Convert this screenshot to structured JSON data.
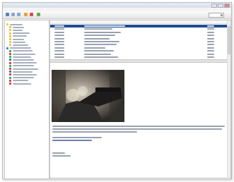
{
  "window": {
    "title": ""
  },
  "menu": [
    "",
    "",
    "",
    "",
    "",
    ""
  ],
  "toolbar": {
    "search_placeholder": ""
  },
  "colors": {
    "selection": "#1f4d8f",
    "folder": "#f0c23b",
    "error": "#d33",
    "accent": "#2f63b6"
  },
  "sidebar": {
    "items": [
      {
        "icon": "folder-icon",
        "color": "#f0c23b"
      },
      {
        "icon": "folder-icon",
        "color": "#f0c23b"
      },
      {
        "icon": "folder-icon",
        "color": "#f0c23b"
      },
      {
        "icon": "folder-icon",
        "color": "#f0c23b"
      },
      {
        "icon": "folder-icon",
        "color": "#f0c23b"
      },
      {
        "icon": "folder-icon",
        "color": "#f0c23b"
      },
      {
        "icon": "folder-icon",
        "color": "#f0c23b"
      },
      {
        "icon": "folder-icon",
        "color": "#f0c23b"
      },
      {
        "icon": "mail-icon",
        "color": "#3b7bd6"
      },
      {
        "icon": "feed-icon",
        "color": "#2da84a"
      },
      {
        "icon": "feed-icon",
        "color": "#d33"
      },
      {
        "icon": "feed-icon",
        "color": "#2da84a"
      },
      {
        "icon": "feed-icon",
        "color": "#2f63b6"
      },
      {
        "icon": "feed-icon",
        "color": "#d33"
      },
      {
        "icon": "feed-icon",
        "color": "#2da84a"
      },
      {
        "icon": "feed-icon",
        "color": "#d33"
      },
      {
        "icon": "feed-icon",
        "color": "#2f63b6"
      },
      {
        "icon": "feed-icon",
        "color": "#d33"
      },
      {
        "icon": "feed-icon",
        "color": "#2da84a"
      },
      {
        "icon": "feed-icon",
        "color": "#d33"
      },
      {
        "icon": "feed-icon",
        "color": "#d33"
      }
    ]
  },
  "list": {
    "headers": [
      "",
      "",
      ""
    ],
    "row_count": 11,
    "selected_index": 0
  },
  "preview": {
    "image": "game-screenshot"
  }
}
